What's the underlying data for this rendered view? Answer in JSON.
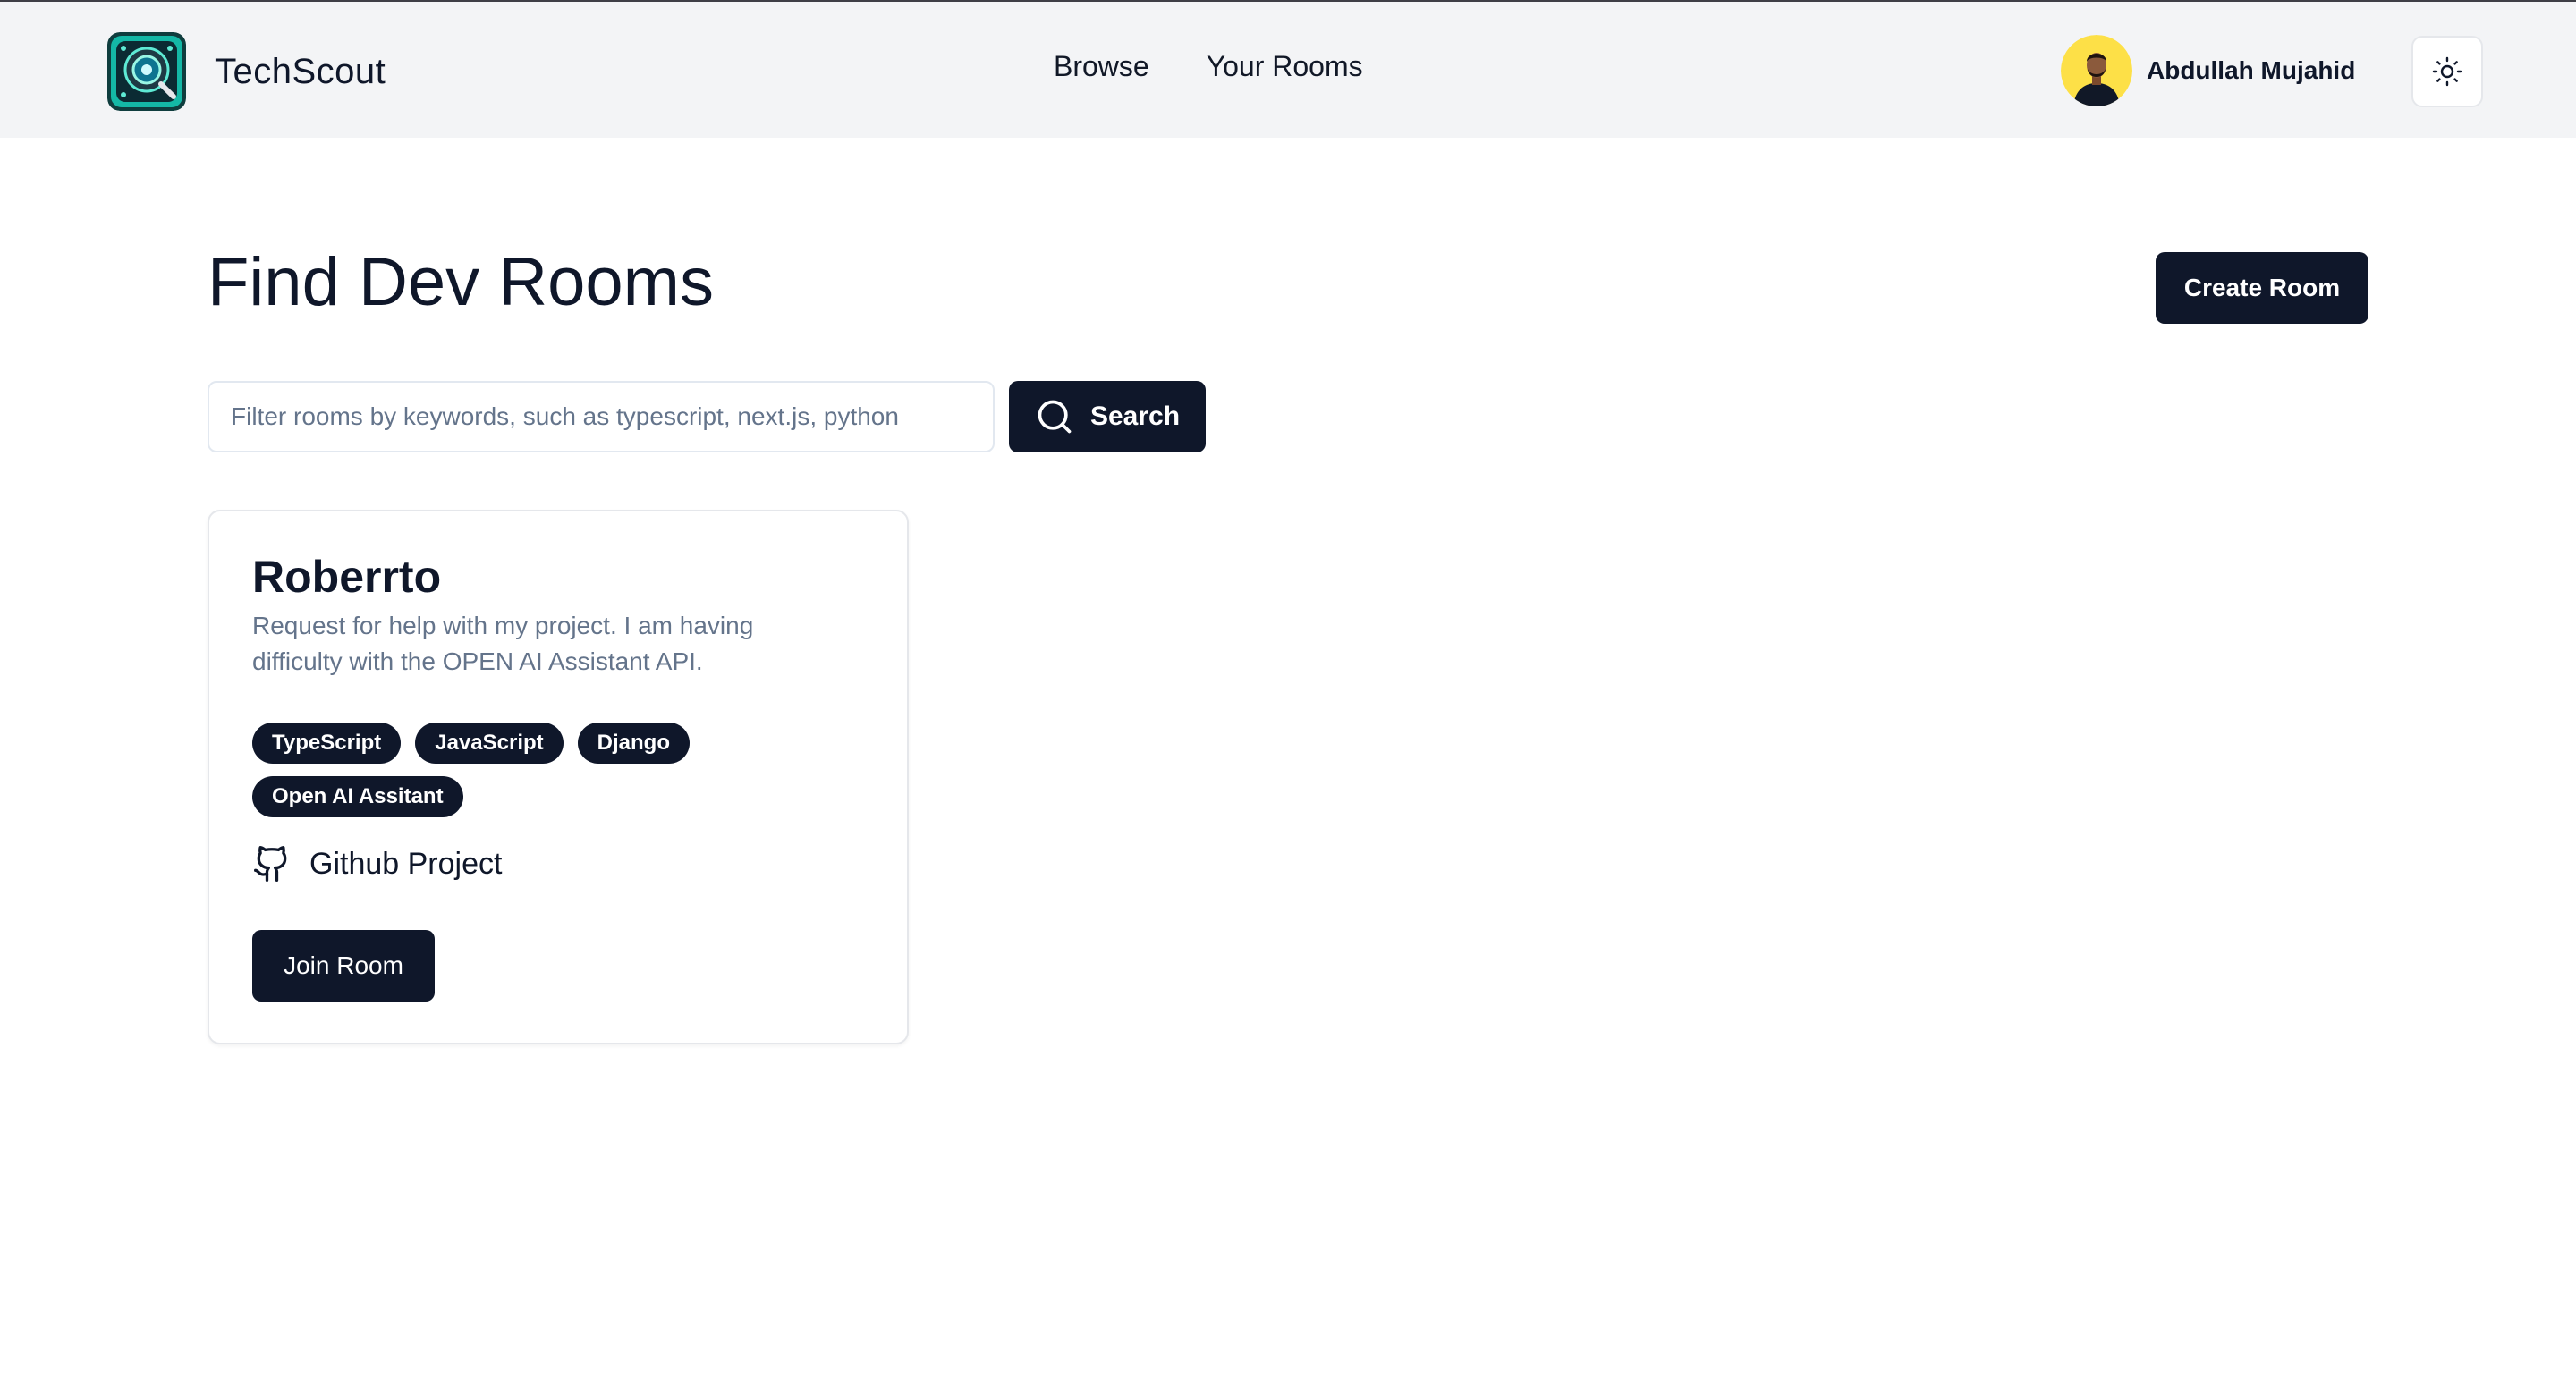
{
  "brand": {
    "name": "TechScout",
    "logo_icon": "scout-logo-icon"
  },
  "nav": {
    "items": [
      {
        "label": "Browse"
      },
      {
        "label": "Your Rooms"
      }
    ]
  },
  "user": {
    "name": "Abdullah Mujahid",
    "avatar_bg": "#fde047"
  },
  "theme_toggle": {
    "icon": "sun-icon"
  },
  "main": {
    "title": "Find Dev Rooms",
    "create_button_label": "Create Room",
    "search": {
      "placeholder": "Filter rooms by keywords, such as typescript, next.js, python",
      "value": "",
      "button_label": "Search",
      "icon": "search-icon"
    }
  },
  "rooms": [
    {
      "name": "Roberrto",
      "description": "Request for help with my project. I am having difficulty with the OPEN AI Assistant API.",
      "tags": [
        "TypeScript",
        "JavaScript",
        "Django",
        "Open AI Assitant"
      ],
      "github_label": "Github Project",
      "github_icon": "github-icon",
      "join_label": "Join Room"
    }
  ],
  "colors": {
    "primary": "#0f172a",
    "header_bg": "#f3f4f6",
    "muted_text": "#64748b"
  }
}
